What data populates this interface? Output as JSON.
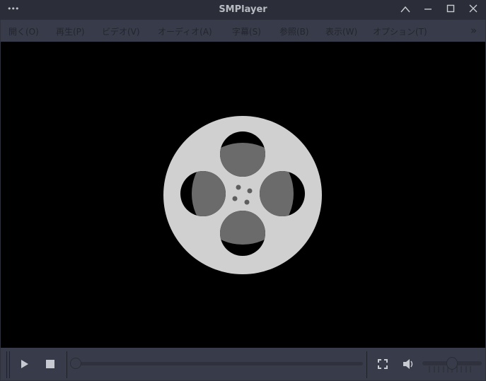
{
  "window": {
    "title": "SMPlayer",
    "menu_dots": "•••"
  },
  "menu": [
    {
      "label": "開く(O)"
    },
    {
      "label": "再生(P)"
    },
    {
      "label": "ビデオ(V)"
    },
    {
      "label": "オーディオ(A)"
    },
    {
      "label": "字幕(S)"
    },
    {
      "label": "参照(B)"
    },
    {
      "label": "表示(W)"
    },
    {
      "label": "オプション(T)"
    }
  ],
  "menu_overflow": "»",
  "controls": {
    "seek_position": 0,
    "volume": 0.5
  },
  "colors": {
    "reel": "#d0d0d0",
    "reel_hub": "#6b6b6b",
    "bar": "#383c4a"
  }
}
